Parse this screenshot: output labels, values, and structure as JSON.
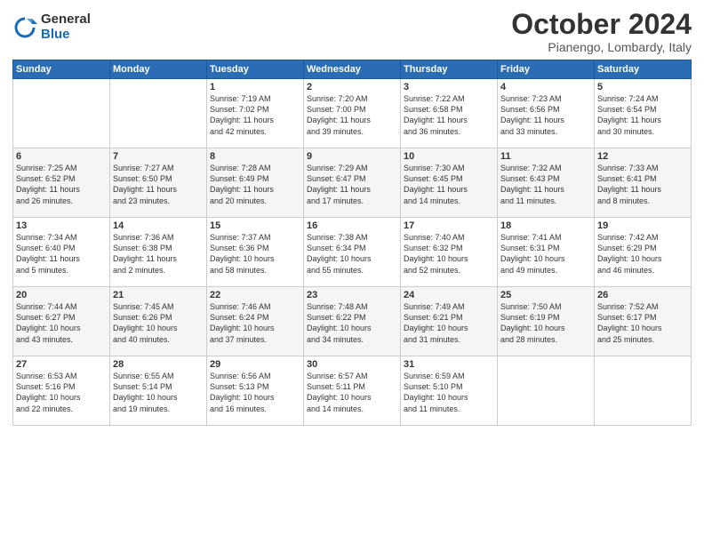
{
  "header": {
    "logo_general": "General",
    "logo_blue": "Blue",
    "month_title": "October 2024",
    "location": "Pianengo, Lombardy, Italy"
  },
  "calendar": {
    "days_of_week": [
      "Sunday",
      "Monday",
      "Tuesday",
      "Wednesday",
      "Thursday",
      "Friday",
      "Saturday"
    ],
    "weeks": [
      [
        {
          "day": "",
          "info": ""
        },
        {
          "day": "",
          "info": ""
        },
        {
          "day": "1",
          "info": "Sunrise: 7:19 AM\nSunset: 7:02 PM\nDaylight: 11 hours\nand 42 minutes."
        },
        {
          "day": "2",
          "info": "Sunrise: 7:20 AM\nSunset: 7:00 PM\nDaylight: 11 hours\nand 39 minutes."
        },
        {
          "day": "3",
          "info": "Sunrise: 7:22 AM\nSunset: 6:58 PM\nDaylight: 11 hours\nand 36 minutes."
        },
        {
          "day": "4",
          "info": "Sunrise: 7:23 AM\nSunset: 6:56 PM\nDaylight: 11 hours\nand 33 minutes."
        },
        {
          "day": "5",
          "info": "Sunrise: 7:24 AM\nSunset: 6:54 PM\nDaylight: 11 hours\nand 30 minutes."
        }
      ],
      [
        {
          "day": "6",
          "info": "Sunrise: 7:25 AM\nSunset: 6:52 PM\nDaylight: 11 hours\nand 26 minutes."
        },
        {
          "day": "7",
          "info": "Sunrise: 7:27 AM\nSunset: 6:50 PM\nDaylight: 11 hours\nand 23 minutes."
        },
        {
          "day": "8",
          "info": "Sunrise: 7:28 AM\nSunset: 6:49 PM\nDaylight: 11 hours\nand 20 minutes."
        },
        {
          "day": "9",
          "info": "Sunrise: 7:29 AM\nSunset: 6:47 PM\nDaylight: 11 hours\nand 17 minutes."
        },
        {
          "day": "10",
          "info": "Sunrise: 7:30 AM\nSunset: 6:45 PM\nDaylight: 11 hours\nand 14 minutes."
        },
        {
          "day": "11",
          "info": "Sunrise: 7:32 AM\nSunset: 6:43 PM\nDaylight: 11 hours\nand 11 minutes."
        },
        {
          "day": "12",
          "info": "Sunrise: 7:33 AM\nSunset: 6:41 PM\nDaylight: 11 hours\nand 8 minutes."
        }
      ],
      [
        {
          "day": "13",
          "info": "Sunrise: 7:34 AM\nSunset: 6:40 PM\nDaylight: 11 hours\nand 5 minutes."
        },
        {
          "day": "14",
          "info": "Sunrise: 7:36 AM\nSunset: 6:38 PM\nDaylight: 11 hours\nand 2 minutes."
        },
        {
          "day": "15",
          "info": "Sunrise: 7:37 AM\nSunset: 6:36 PM\nDaylight: 10 hours\nand 58 minutes."
        },
        {
          "day": "16",
          "info": "Sunrise: 7:38 AM\nSunset: 6:34 PM\nDaylight: 10 hours\nand 55 minutes."
        },
        {
          "day": "17",
          "info": "Sunrise: 7:40 AM\nSunset: 6:32 PM\nDaylight: 10 hours\nand 52 minutes."
        },
        {
          "day": "18",
          "info": "Sunrise: 7:41 AM\nSunset: 6:31 PM\nDaylight: 10 hours\nand 49 minutes."
        },
        {
          "day": "19",
          "info": "Sunrise: 7:42 AM\nSunset: 6:29 PM\nDaylight: 10 hours\nand 46 minutes."
        }
      ],
      [
        {
          "day": "20",
          "info": "Sunrise: 7:44 AM\nSunset: 6:27 PM\nDaylight: 10 hours\nand 43 minutes."
        },
        {
          "day": "21",
          "info": "Sunrise: 7:45 AM\nSunset: 6:26 PM\nDaylight: 10 hours\nand 40 minutes."
        },
        {
          "day": "22",
          "info": "Sunrise: 7:46 AM\nSunset: 6:24 PM\nDaylight: 10 hours\nand 37 minutes."
        },
        {
          "day": "23",
          "info": "Sunrise: 7:48 AM\nSunset: 6:22 PM\nDaylight: 10 hours\nand 34 minutes."
        },
        {
          "day": "24",
          "info": "Sunrise: 7:49 AM\nSunset: 6:21 PM\nDaylight: 10 hours\nand 31 minutes."
        },
        {
          "day": "25",
          "info": "Sunrise: 7:50 AM\nSunset: 6:19 PM\nDaylight: 10 hours\nand 28 minutes."
        },
        {
          "day": "26",
          "info": "Sunrise: 7:52 AM\nSunset: 6:17 PM\nDaylight: 10 hours\nand 25 minutes."
        }
      ],
      [
        {
          "day": "27",
          "info": "Sunrise: 6:53 AM\nSunset: 5:16 PM\nDaylight: 10 hours\nand 22 minutes."
        },
        {
          "day": "28",
          "info": "Sunrise: 6:55 AM\nSunset: 5:14 PM\nDaylight: 10 hours\nand 19 minutes."
        },
        {
          "day": "29",
          "info": "Sunrise: 6:56 AM\nSunset: 5:13 PM\nDaylight: 10 hours\nand 16 minutes."
        },
        {
          "day": "30",
          "info": "Sunrise: 6:57 AM\nSunset: 5:11 PM\nDaylight: 10 hours\nand 14 minutes."
        },
        {
          "day": "31",
          "info": "Sunrise: 6:59 AM\nSunset: 5:10 PM\nDaylight: 10 hours\nand 11 minutes."
        },
        {
          "day": "",
          "info": ""
        },
        {
          "day": "",
          "info": ""
        }
      ]
    ]
  }
}
